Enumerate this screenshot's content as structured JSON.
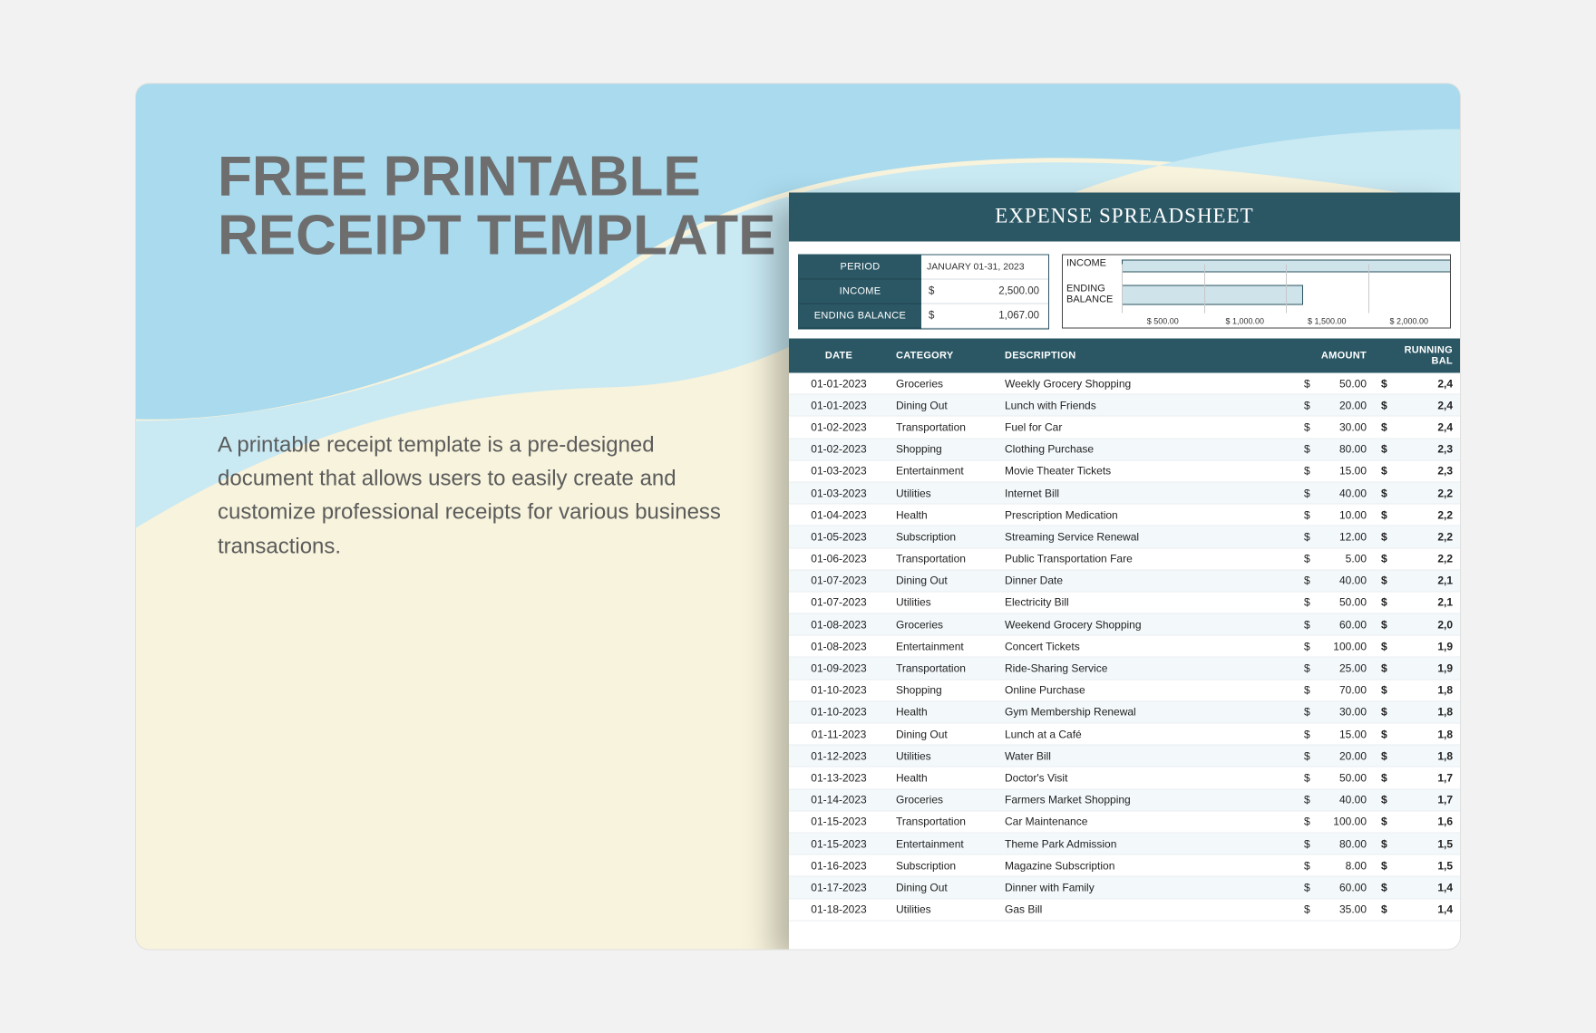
{
  "headline": {
    "line1": "FREE PRINTABLE",
    "line2": "RECEIPT TEMPLATE"
  },
  "description": "A printable receipt template is a pre-designed document that allows users to easily create and customize professional receipts for various business transactions.",
  "sheet": {
    "title": "EXPENSE SPREADSHEET",
    "summary": {
      "period_label": "PERIOD",
      "period_value": "JANUARY 01-31, 2023",
      "income_label": "INCOME",
      "income_value": "2,500.00",
      "ending_label": "ENDING BALANCE",
      "ending_value": "1,067.00",
      "currency": "$"
    },
    "mini": {
      "income_label": "INCOME",
      "ending_label": "ENDING BALANCE",
      "ticks": [
        "$ 500.00",
        "$ 1,000.00",
        "$ 1,500.00",
        "$ 2,000.00"
      ]
    },
    "columns": {
      "date": "DATE",
      "category": "CATEGORY",
      "description": "DESCRIPTION",
      "amount": "AMOUNT",
      "running": "RUNNING BAL"
    },
    "currency": "$",
    "rows": [
      {
        "date": "01-01-2023",
        "category": "Groceries",
        "description": "Weekly Grocery Shopping",
        "amount": "50.00",
        "running": "2,4"
      },
      {
        "date": "01-01-2023",
        "category": "Dining Out",
        "description": "Lunch with Friends",
        "amount": "20.00",
        "running": "2,4"
      },
      {
        "date": "01-02-2023",
        "category": "Transportation",
        "description": "Fuel for Car",
        "amount": "30.00",
        "running": "2,4"
      },
      {
        "date": "01-02-2023",
        "category": "Shopping",
        "description": "Clothing Purchase",
        "amount": "80.00",
        "running": "2,3"
      },
      {
        "date": "01-03-2023",
        "category": "Entertainment",
        "description": "Movie Theater Tickets",
        "amount": "15.00",
        "running": "2,3"
      },
      {
        "date": "01-03-2023",
        "category": "Utilities",
        "description": "Internet Bill",
        "amount": "40.00",
        "running": "2,2"
      },
      {
        "date": "01-04-2023",
        "category": "Health",
        "description": "Prescription Medication",
        "amount": "10.00",
        "running": "2,2"
      },
      {
        "date": "01-05-2023",
        "category": "Subscription",
        "description": "Streaming Service Renewal",
        "amount": "12.00",
        "running": "2,2"
      },
      {
        "date": "01-06-2023",
        "category": "Transportation",
        "description": "Public Transportation Fare",
        "amount": "5.00",
        "running": "2,2"
      },
      {
        "date": "01-07-2023",
        "category": "Dining Out",
        "description": "Dinner Date",
        "amount": "40.00",
        "running": "2,1"
      },
      {
        "date": "01-07-2023",
        "category": "Utilities",
        "description": "Electricity Bill",
        "amount": "50.00",
        "running": "2,1"
      },
      {
        "date": "01-08-2023",
        "category": "Groceries",
        "description": "Weekend Grocery Shopping",
        "amount": "60.00",
        "running": "2,0"
      },
      {
        "date": "01-08-2023",
        "category": "Entertainment",
        "description": "Concert Tickets",
        "amount": "100.00",
        "running": "1,9"
      },
      {
        "date": "01-09-2023",
        "category": "Transportation",
        "description": "Ride-Sharing Service",
        "amount": "25.00",
        "running": "1,9"
      },
      {
        "date": "01-10-2023",
        "category": "Shopping",
        "description": "Online Purchase",
        "amount": "70.00",
        "running": "1,8"
      },
      {
        "date": "01-10-2023",
        "category": "Health",
        "description": "Gym Membership Renewal",
        "amount": "30.00",
        "running": "1,8"
      },
      {
        "date": "01-11-2023",
        "category": "Dining Out",
        "description": "Lunch at a Café",
        "amount": "15.00",
        "running": "1,8"
      },
      {
        "date": "01-12-2023",
        "category": "Utilities",
        "description": "Water Bill",
        "amount": "20.00",
        "running": "1,8"
      },
      {
        "date": "01-13-2023",
        "category": "Health",
        "description": "Doctor's Visit",
        "amount": "50.00",
        "running": "1,7"
      },
      {
        "date": "01-14-2023",
        "category": "Groceries",
        "description": "Farmers Market Shopping",
        "amount": "40.00",
        "running": "1,7"
      },
      {
        "date": "01-15-2023",
        "category": "Transportation",
        "description": "Car Maintenance",
        "amount": "100.00",
        "running": "1,6"
      },
      {
        "date": "01-15-2023",
        "category": "Entertainment",
        "description": "Theme Park Admission",
        "amount": "80.00",
        "running": "1,5"
      },
      {
        "date": "01-16-2023",
        "category": "Subscription",
        "description": "Magazine Subscription",
        "amount": "8.00",
        "running": "1,5"
      },
      {
        "date": "01-17-2023",
        "category": "Dining Out",
        "description": "Dinner with Family",
        "amount": "60.00",
        "running": "1,4"
      },
      {
        "date": "01-18-2023",
        "category": "Utilities",
        "description": "Gas Bill",
        "amount": "35.00",
        "running": "1,4"
      }
    ]
  }
}
